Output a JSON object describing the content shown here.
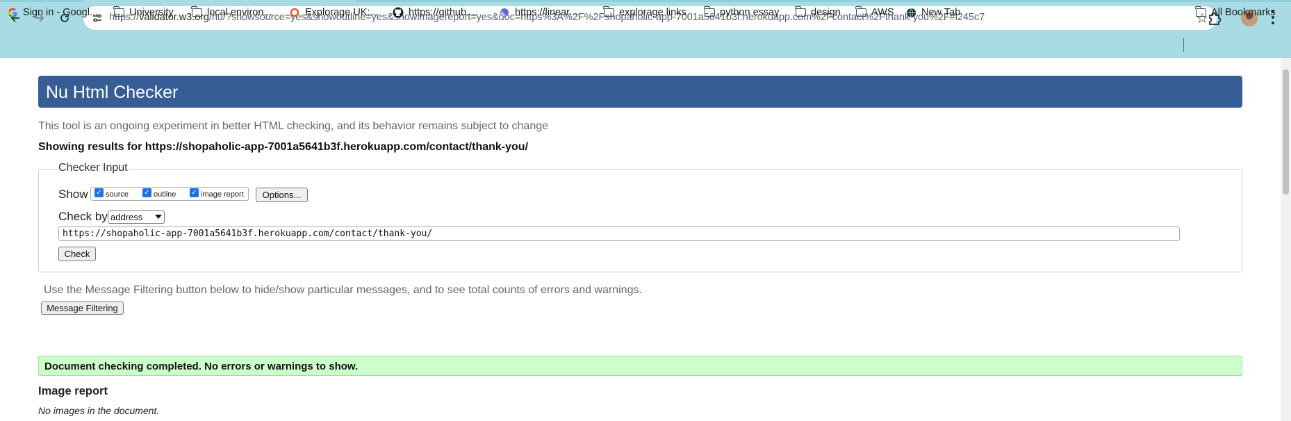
{
  "browser": {
    "url_host": "validator.w3.org",
    "url_prefix": "https://",
    "url_path": "/nu/?showsource=yes&showoutline=yes&showimagereport=yes&doc=https%3A%2F%2Fshopaholic-app-7001a5641b3f.herokuapp.com%2Fcontact%2Fthank-you%2F#l245c7",
    "bookmarks": [
      {
        "label": "Sign in - Googl...",
        "icon": "google-icon"
      },
      {
        "label": "University",
        "icon": "folder-icon"
      },
      {
        "label": "local environ...",
        "icon": "folder-icon"
      },
      {
        "label": "Explorage UK:...",
        "icon": "explorage-icon"
      },
      {
        "label": "https://github....",
        "icon": "github-icon"
      },
      {
        "label": "https://linear....",
        "icon": "linear-icon"
      },
      {
        "label": "explorage links",
        "icon": "folder-icon"
      },
      {
        "label": "python essay",
        "icon": "folder-icon"
      },
      {
        "label": "design",
        "icon": "folder-icon"
      },
      {
        "label": "AWS",
        "icon": "folder-icon"
      },
      {
        "label": "New Tab",
        "icon": "globe-icon"
      }
    ],
    "all_bookmarks": "All Bookmarks"
  },
  "checker": {
    "title": "Nu Html Checker",
    "tagline": "This tool is an ongoing experiment in better HTML checking, and its behavior remains subject to change",
    "results_for": "Showing results for https://shopaholic-app-7001a5641b3f.herokuapp.com/contact/thank-you/",
    "legend": "Checker Input",
    "show_label": "Show",
    "options": [
      {
        "label": "source",
        "checked": true
      },
      {
        "label": "outline",
        "checked": true
      },
      {
        "label": "image report",
        "checked": true
      }
    ],
    "options_button": "Options...",
    "check_by_label": "Check by",
    "check_by_value": "address",
    "address_value": "https://shopaholic-app-7001a5641b3f.herokuapp.com/contact/thank-you/",
    "check_button": "Check",
    "filter_note": "Use the Message Filtering button below to hide/show particular messages, and to see total counts of errors and warnings.",
    "filter_button": "Message Filtering",
    "success_message": "Document checking completed. No errors or warnings to show.",
    "image_report_heading": "Image report",
    "no_images": "No images in the document."
  },
  "colors": {
    "chrome": "#a8dbe3",
    "header": "#365d95",
    "success": "#ccffcc"
  }
}
